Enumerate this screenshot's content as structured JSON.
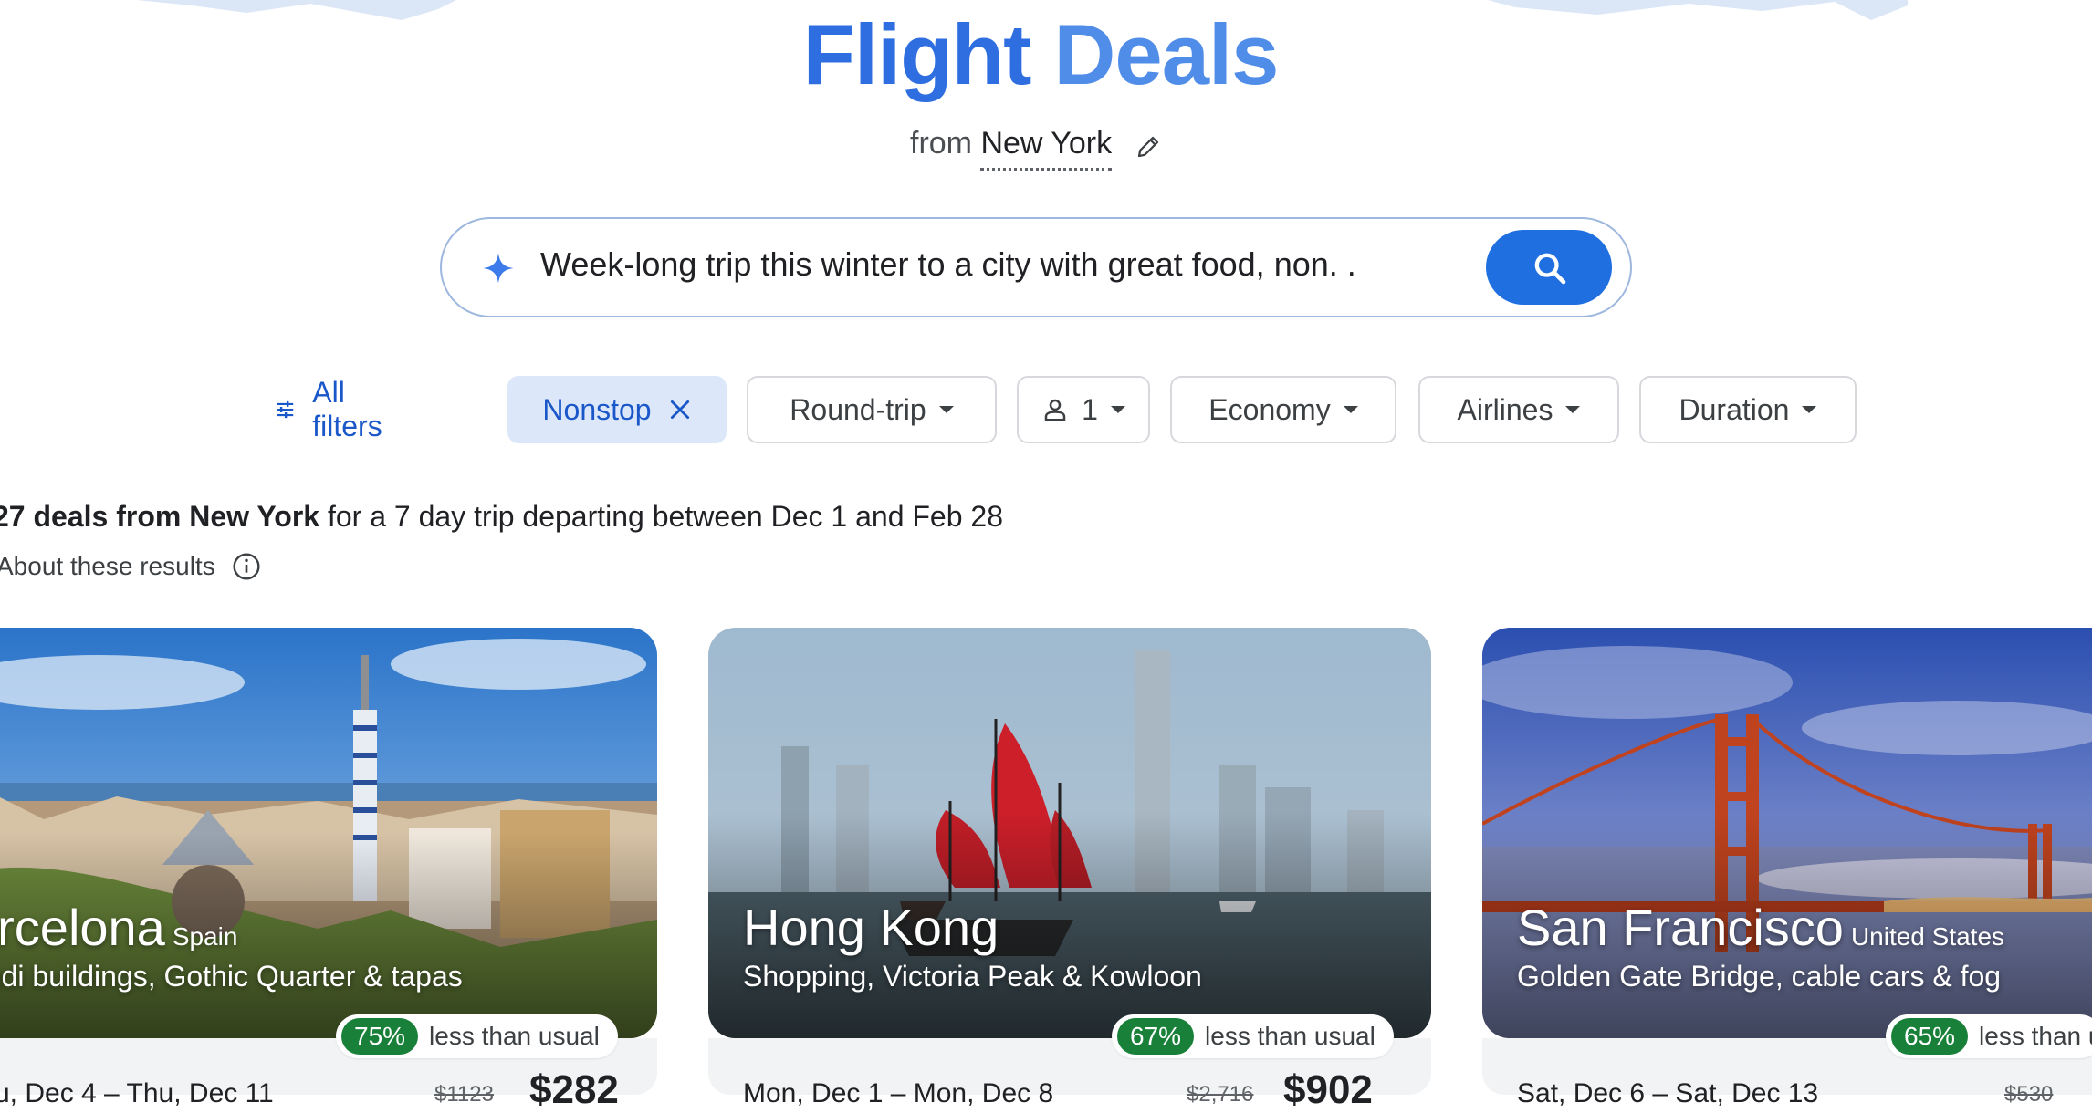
{
  "header": {
    "title_word1": "Flight",
    "title_word2": "Deals",
    "from_prefix": "from",
    "from_city": "New York"
  },
  "search": {
    "query": "Week-long trip this winter to a city with great food, non. ."
  },
  "filters": {
    "all_filters": "All filters",
    "nonstop": "Nonstop",
    "trip_type": "Round-trip",
    "passengers": "1",
    "cabin": "Economy",
    "airlines": "Airlines",
    "duration": "Duration"
  },
  "results": {
    "summary_bold": "27 deals from New York",
    "summary_rest": " for a 7 day trip departing between Dec 1 and Feb 28",
    "about": "About these results"
  },
  "cards": [
    {
      "city": "arcelona",
      "country": "Spain",
      "tagline": "audi buildings, Gothic Quarter & tapas",
      "deal_pct": "75%",
      "deal_text": "less than usual",
      "dates": "u, Dec 4 – Thu, Dec 11",
      "old_price": "$1123",
      "price": "$282"
    },
    {
      "city": "Hong Kong",
      "country": "",
      "tagline": "Shopping, Victoria Peak & Kowloon",
      "deal_pct": "67%",
      "deal_text": "less than usual",
      "dates": "Mon, Dec 1 – Mon, Dec 8",
      "old_price": "$2,716",
      "price": "$902"
    },
    {
      "city": "San Francisco",
      "country": "United States",
      "tagline": "Golden Gate Bridge, cable cars & fog",
      "deal_pct": "65%",
      "deal_text": "less than u",
      "dates": "Sat, Dec 6 – Sat, Dec 13",
      "old_price": "$530",
      "price": ""
    }
  ],
  "colors": {
    "accent": "#1f6fe0",
    "chip_selected_bg": "#dce8fa",
    "deal_green": "#188038"
  },
  "icons": {
    "edit": "pencil-icon",
    "sparkle": "sparkle-icon",
    "search": "search-icon",
    "filters": "tune-icon",
    "close": "close-icon",
    "person": "person-icon",
    "info": "info-icon"
  }
}
